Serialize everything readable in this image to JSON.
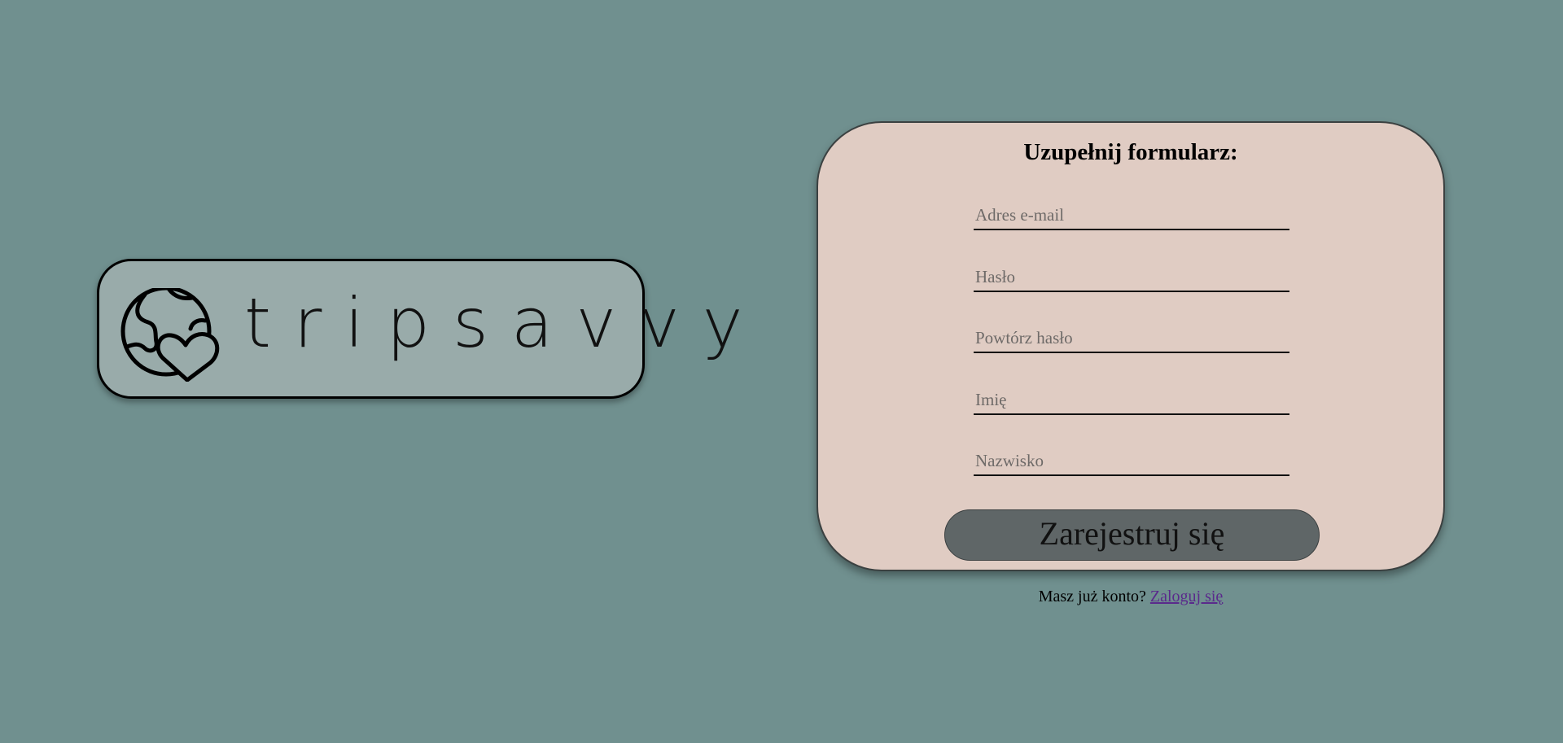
{
  "logo": {
    "brand_text": "tripsavvy",
    "icon": "globe-heart-icon"
  },
  "form": {
    "title": "Uzupełnij formularz:",
    "fields": [
      {
        "placeholder": "Adres e-mail",
        "value": ""
      },
      {
        "placeholder": "Hasło",
        "value": ""
      },
      {
        "placeholder": "Powtórz hasło",
        "value": ""
      },
      {
        "placeholder": "Imię",
        "value": ""
      },
      {
        "placeholder": "Nazwisko",
        "value": ""
      }
    ],
    "submit_label": "Zarejestruj się"
  },
  "login": {
    "prompt": "Masz już konto?",
    "link_label": "Zaloguj się"
  },
  "colors": {
    "page_background": "#70908f",
    "logo_background": "#99abaa",
    "form_background": "#e0ccc3",
    "button_background": "#5f6667",
    "link": "#5a2a8c"
  }
}
